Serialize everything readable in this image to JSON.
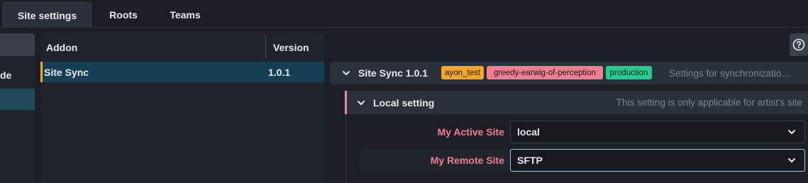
{
  "tabs": [
    {
      "label": "Site settings",
      "active": true
    },
    {
      "label": "Roots",
      "active": false
    },
    {
      "label": "Teams",
      "active": false
    }
  ],
  "sidebar": {
    "items": [
      {
        "label": "de"
      }
    ]
  },
  "addons_table": {
    "columns": [
      "Addon",
      "Version"
    ],
    "rows": [
      {
        "addon": "Site Sync",
        "version": "1.0.1"
      }
    ]
  },
  "settings": {
    "section": {
      "title": "Site Sync 1.0.1",
      "badges": [
        {
          "label": "ayon_test",
          "color": "#f5a623"
        },
        {
          "label": "greedy-earwig-of-perception",
          "color": "#f07d92"
        },
        {
          "label": "production",
          "color": "#1fcf8f"
        }
      ],
      "description": "Settings for synchronizatio..."
    },
    "subsection": {
      "title": "Local setting",
      "description": "This setting is only applicable for artist's site"
    },
    "fields": [
      {
        "label": "My Active Site",
        "value": "local"
      },
      {
        "label": "My Remote Site",
        "value": "SFTP"
      }
    ]
  },
  "icons": {
    "help": "help-circle-icon",
    "collapse": "chevron-down-icon",
    "dropdown": "chevron-down-icon"
  }
}
